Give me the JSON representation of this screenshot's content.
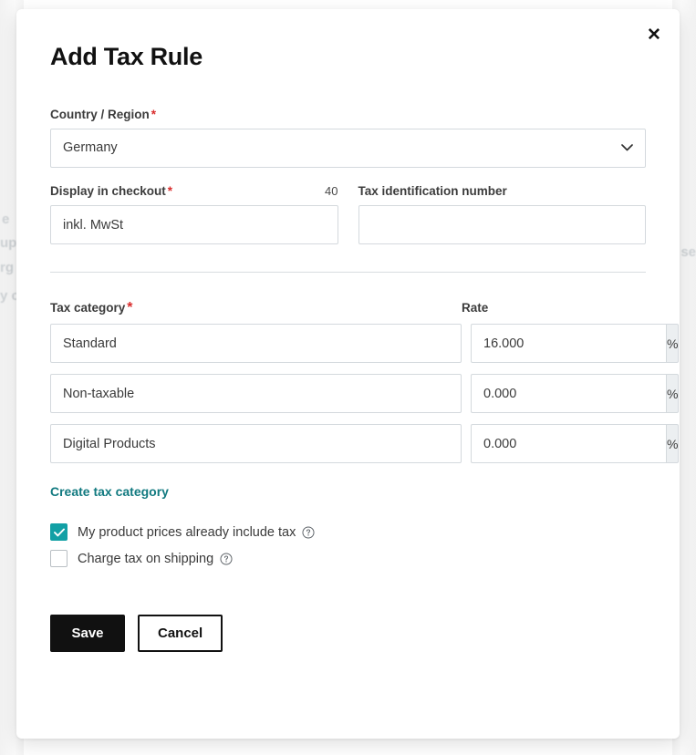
{
  "backdrop": {
    "ghost_fragments": [
      "e",
      "up",
      "rg",
      "y c",
      "se"
    ]
  },
  "modal": {
    "title": "Add Tax Rule",
    "close_label": "✕",
    "country": {
      "label": "Country / Region",
      "required_mark": "*",
      "value": "Germany",
      "chevron": "chevron-down"
    },
    "display_in_checkout": {
      "label": "Display in checkout",
      "required_mark": "*",
      "char_count": "40",
      "value": "inkl. MwSt",
      "placeholder": ""
    },
    "tax_id": {
      "label": "Tax identification number",
      "value": "",
      "placeholder": ""
    },
    "categories_section": {
      "header_category": "Tax category",
      "header_category_required": "*",
      "header_rate": "Rate",
      "rate_suffix": "%",
      "rows": [
        {
          "name": "Standard",
          "rate": "16.000"
        },
        {
          "name": "Non-taxable",
          "rate": "0.000"
        },
        {
          "name": "Digital Products",
          "rate": "0.000"
        }
      ],
      "create_link": "Create tax category"
    },
    "options": [
      {
        "label": "My product prices already include tax",
        "checked": true,
        "help": "?"
      },
      {
        "label": "Charge tax on shipping",
        "checked": false,
        "help": "?"
      }
    ],
    "buttons": {
      "save": "Save",
      "cancel": "Cancel"
    }
  },
  "colors": {
    "accent_teal": "#12a0a5",
    "link_teal": "#127a80",
    "required_red": "#d92b2b",
    "primary_button": "#111111",
    "suffix_bg": "#eceff1",
    "border": "#d4d9dd"
  }
}
